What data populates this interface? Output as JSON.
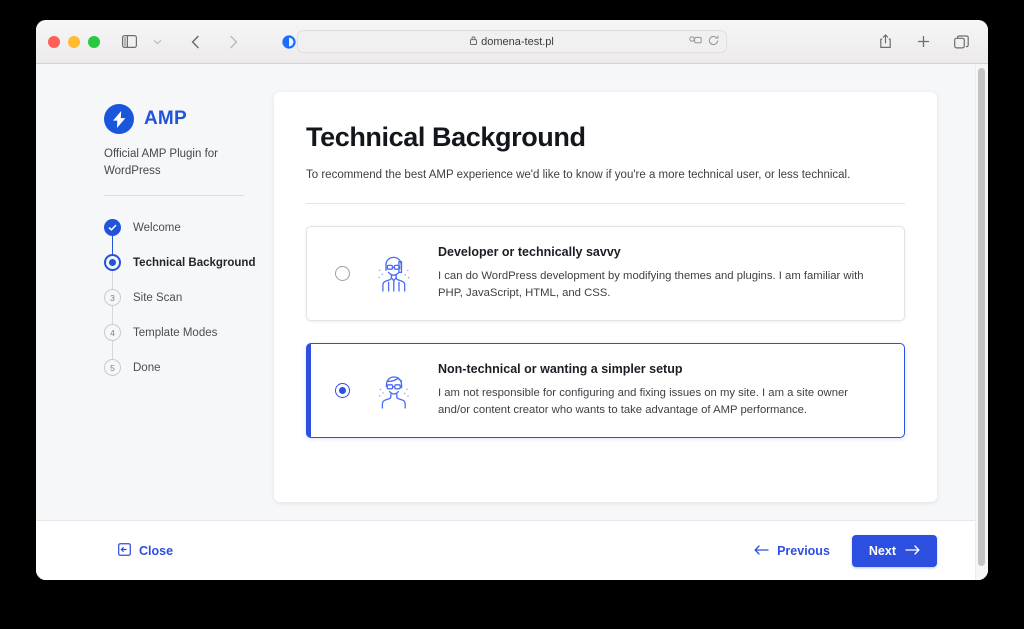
{
  "browser": {
    "traffic_lights": [
      "close",
      "minimize",
      "zoom"
    ],
    "sidebar_toggle_icon": "sidebar-icon",
    "tab_dropdown_icon": "chevron-down-icon",
    "back_icon": "chevron-left-icon",
    "forward_icon": "chevron-right-icon",
    "extension_icon": "extension-icon",
    "privacy_shield_icon": "shield-icon",
    "address": {
      "lock_icon": "lock-icon",
      "url": "domena-test.pl",
      "extensions_icon": "puzzle-icon",
      "reload_icon": "reload-icon"
    },
    "share_icon": "share-icon",
    "new_tab_icon": "plus-icon",
    "tab_overview_icon": "tabs-icon"
  },
  "sidebar": {
    "logo_icon": "amp-bolt-icon",
    "brand": "AMP",
    "subtitle": "Official AMP Plugin for WordPress",
    "steps": [
      {
        "label": "Welcome",
        "state": "done",
        "marker": "check-icon"
      },
      {
        "label": "Technical Background",
        "state": "current",
        "marker": "dot"
      },
      {
        "label": "Site Scan",
        "state": "todo",
        "marker": "3"
      },
      {
        "label": "Template Modes",
        "state": "todo",
        "marker": "4"
      },
      {
        "label": "Done",
        "state": "todo",
        "marker": "5"
      }
    ]
  },
  "main": {
    "title": "Technical Background",
    "description": "To recommend the best AMP experience we'd like to know if you're a more technical user, or less technical.",
    "options": [
      {
        "title": "Developer or technically savvy",
        "description": "I can do WordPress development by modifying themes and plugins. I am familiar with PHP, JavaScript, HTML, and CSS.",
        "selected": false,
        "illustration": "developer-avatar-icon"
      },
      {
        "title": "Non-technical or wanting a simpler setup",
        "description": "I am not responsible for configuring and fixing issues on my site. I am a site owner and/or content creator who wants to take advantage of AMP performance.",
        "selected": true,
        "illustration": "non-technical-avatar-icon"
      }
    ]
  },
  "footer": {
    "close_label": "Close",
    "close_icon": "exit-icon",
    "previous_label": "Previous",
    "previous_icon": "arrow-left-icon",
    "next_label": "Next",
    "next_icon": "arrow-right-icon"
  },
  "colors": {
    "accent": "#2d4fe0",
    "brand_blue": "#2154d8",
    "page_bg": "#f6f7f8",
    "card_bg": "#ffffff",
    "text_primary": "#13161c",
    "text_secondary": "#3d4045"
  }
}
